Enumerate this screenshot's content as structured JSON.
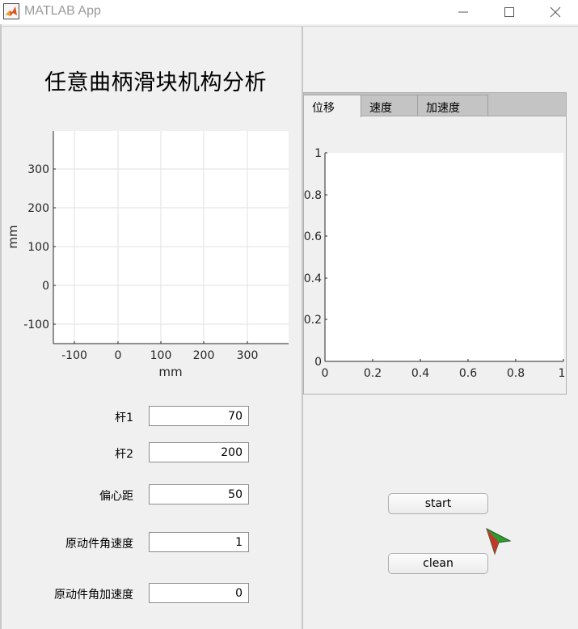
{
  "window": {
    "title": "MATLAB App",
    "minimize_label": "—",
    "maximize_label": "☐",
    "close_label": "✕"
  },
  "left_panel": {
    "heading": "任意曲柄滑块机构分析",
    "mechanism_axes": {
      "xlabel": "mm",
      "ylabel": "mm",
      "x_ticks": [
        "-100",
        "0",
        "100",
        "200",
        "300"
      ],
      "y_ticks": [
        "300",
        "200",
        "100",
        "0",
        "-100"
      ],
      "grid": true
    },
    "fields": [
      {
        "label": "杆1",
        "value": "70"
      },
      {
        "label": "杆2",
        "value": "200"
      },
      {
        "label": "偏心距",
        "value": "50"
      },
      {
        "label": "原动件角速度",
        "value": "1"
      },
      {
        "label": "原动件角加速度",
        "value": "0"
      }
    ]
  },
  "right_panel": {
    "tabs": [
      {
        "label": "位移",
        "active": true
      },
      {
        "label": "速度",
        "active": false
      },
      {
        "label": "加速度",
        "active": false
      }
    ],
    "plot_axes": {
      "x_ticks": [
        "0",
        "0.2",
        "0.4",
        "0.6",
        "0.8",
        "1"
      ],
      "y_ticks": [
        "1",
        "0.8",
        "0.6",
        "0.4",
        "0.2",
        "0"
      ]
    },
    "start_button": "start",
    "clean_button": "clean"
  },
  "colors": {
    "background": "#f0f0f0",
    "plot_background": "#ffffff",
    "logo_red": "#c0392b",
    "logo_green": "#2e9b2e"
  }
}
